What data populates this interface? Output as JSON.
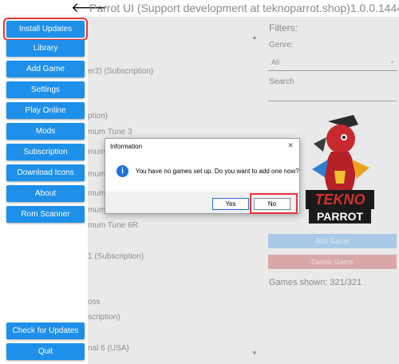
{
  "window": {
    "back_arrow": "🡐",
    "title": "Parrot UI (Support development at teknoparrot.shop)1.0.0.1444"
  },
  "sidebar": {
    "buttons": [
      "Install Updates",
      "Library",
      "Add Game",
      "Settings",
      "Play Online",
      "Mods",
      "Subscription",
      "Download Icons",
      "About",
      "Rom Scanner"
    ],
    "bottom_buttons": [
      "Check for Updates",
      "Quit"
    ]
  },
  "game_list": {
    "items": [
      "er2) (Subscription)",
      "ption)",
      "mum Tune 3",
      "mum",
      "mum",
      "mum",
      "mum",
      "mum Tune 6R",
      "1 (Subscription)",
      "oss",
      "scription)",
      "nal 6 (USA)"
    ]
  },
  "filters": {
    "title": "Filters:",
    "genre_label": "Genre:",
    "genre_value": "All",
    "search_label": "Search",
    "add_game_label": "Add Game",
    "delete_game_label": "Delete Game",
    "games_shown": "Games shown: 321/321"
  },
  "logo": {
    "text_top": "TEKNO",
    "text_bottom": "PARROT"
  },
  "dialog": {
    "title": "Information",
    "close": "✕",
    "icon": "i",
    "message": "You have no games set up. Do you want to add one now?",
    "yes_label": "Yes",
    "no_label": "No"
  },
  "colors": {
    "sidebar_button": "#1e90ea",
    "highlight": "#e8343a",
    "info_icon": "#1e73d6"
  }
}
